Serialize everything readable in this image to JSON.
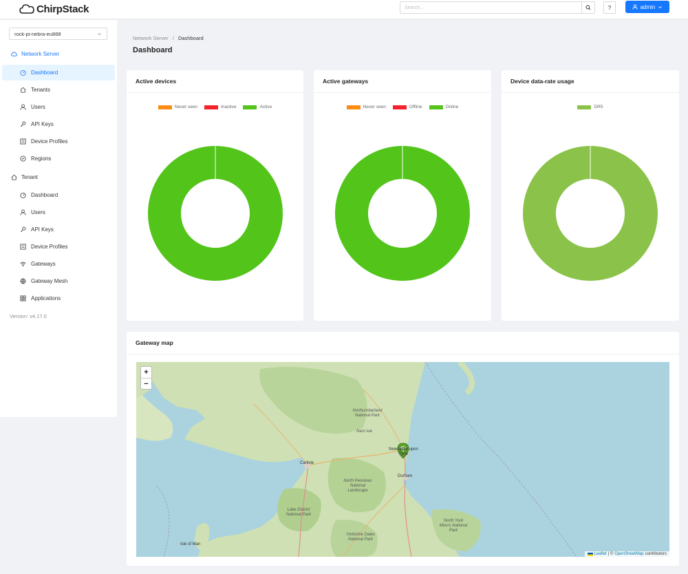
{
  "header": {
    "brand": "ChirpStack",
    "search_placeholder": "Search...",
    "help_label": "?",
    "user_label": "admin"
  },
  "sidebar": {
    "tenant_selected": "rock-pi-nebra-eu868",
    "network_server_label": "Network Server",
    "network_server_items": [
      {
        "label": "Dashboard",
        "icon": "dashboard-icon"
      },
      {
        "label": "Tenants",
        "icon": "home-icon"
      },
      {
        "label": "Users",
        "icon": "user-icon"
      },
      {
        "label": "API Keys",
        "icon": "key-icon"
      },
      {
        "label": "Device Profiles",
        "icon": "profile-icon"
      },
      {
        "label": "Regions",
        "icon": "compass-icon"
      }
    ],
    "tenant_label": "Tenant",
    "tenant_items": [
      {
        "label": "Dashboard",
        "icon": "dashboard-icon"
      },
      {
        "label": "Users",
        "icon": "user-icon"
      },
      {
        "label": "API Keys",
        "icon": "key-icon"
      },
      {
        "label": "Device Profiles",
        "icon": "profile-icon"
      },
      {
        "label": "Gateways",
        "icon": "wifi-icon"
      },
      {
        "label": "Gateway Mesh",
        "icon": "mesh-icon"
      },
      {
        "label": "Applications",
        "icon": "apps-icon"
      }
    ],
    "version": "Version: v4.17.0"
  },
  "main": {
    "breadcrumb": [
      "Network Server",
      "Dashboard"
    ],
    "breadcrumb_sep": "/",
    "title": "Dashboard",
    "cards": {
      "active_devices": {
        "title": "Active devices",
        "legend": [
          {
            "label": "Never seen",
            "color": "#fa8c16"
          },
          {
            "label": "Inactive",
            "color": "#f5222d"
          },
          {
            "label": "Active",
            "color": "#52c41a"
          }
        ]
      },
      "active_gateways": {
        "title": "Active gateways",
        "legend": [
          {
            "label": "Never seen",
            "color": "#fa8c16"
          },
          {
            "label": "Offline",
            "color": "#f5222d"
          },
          {
            "label": "Online",
            "color": "#52c41a"
          }
        ]
      },
      "dr_usage": {
        "title": "Device data-rate usage",
        "legend": [
          {
            "label": "DR5",
            "color": "#8bc34a"
          }
        ]
      }
    },
    "map": {
      "title": "Gateway map",
      "zoom_in": "+",
      "zoom_out": "−",
      "attribution_leaflet": "Leaflet",
      "attribution_sep": "| ©",
      "attribution_osm": "OpenStreetMap",
      "attribution_tail": "contributors",
      "places": {
        "newcastle": "Newcastle upon Tyne",
        "carlisle": "Carlisle",
        "durham": "Durham",
        "northumberland": "Northumberland National Park",
        "north_pennines": "North Pennines National Landscape",
        "lake_district": "Lake District National Park",
        "yorkshire_dales": "Yorkshire Dales National Park",
        "north_york": "North York Moors National Park",
        "isle_of_man": "Isle of Man",
        "narn": "Narn Iue"
      }
    }
  },
  "chart_data": [
    {
      "type": "pie",
      "title": "Active devices",
      "categories": [
        "Never seen",
        "Inactive",
        "Active"
      ],
      "values": [
        0,
        0,
        1
      ],
      "colors": [
        "#fa8c16",
        "#f5222d",
        "#52c41a"
      ]
    },
    {
      "type": "pie",
      "title": "Active gateways",
      "categories": [
        "Never seen",
        "Offline",
        "Online"
      ],
      "values": [
        0,
        0,
        1
      ],
      "colors": [
        "#fa8c16",
        "#f5222d",
        "#52c41a"
      ]
    },
    {
      "type": "pie",
      "title": "Device data-rate usage",
      "categories": [
        "DR5"
      ],
      "values": [
        1
      ],
      "colors": [
        "#8bc34a"
      ]
    }
  ]
}
